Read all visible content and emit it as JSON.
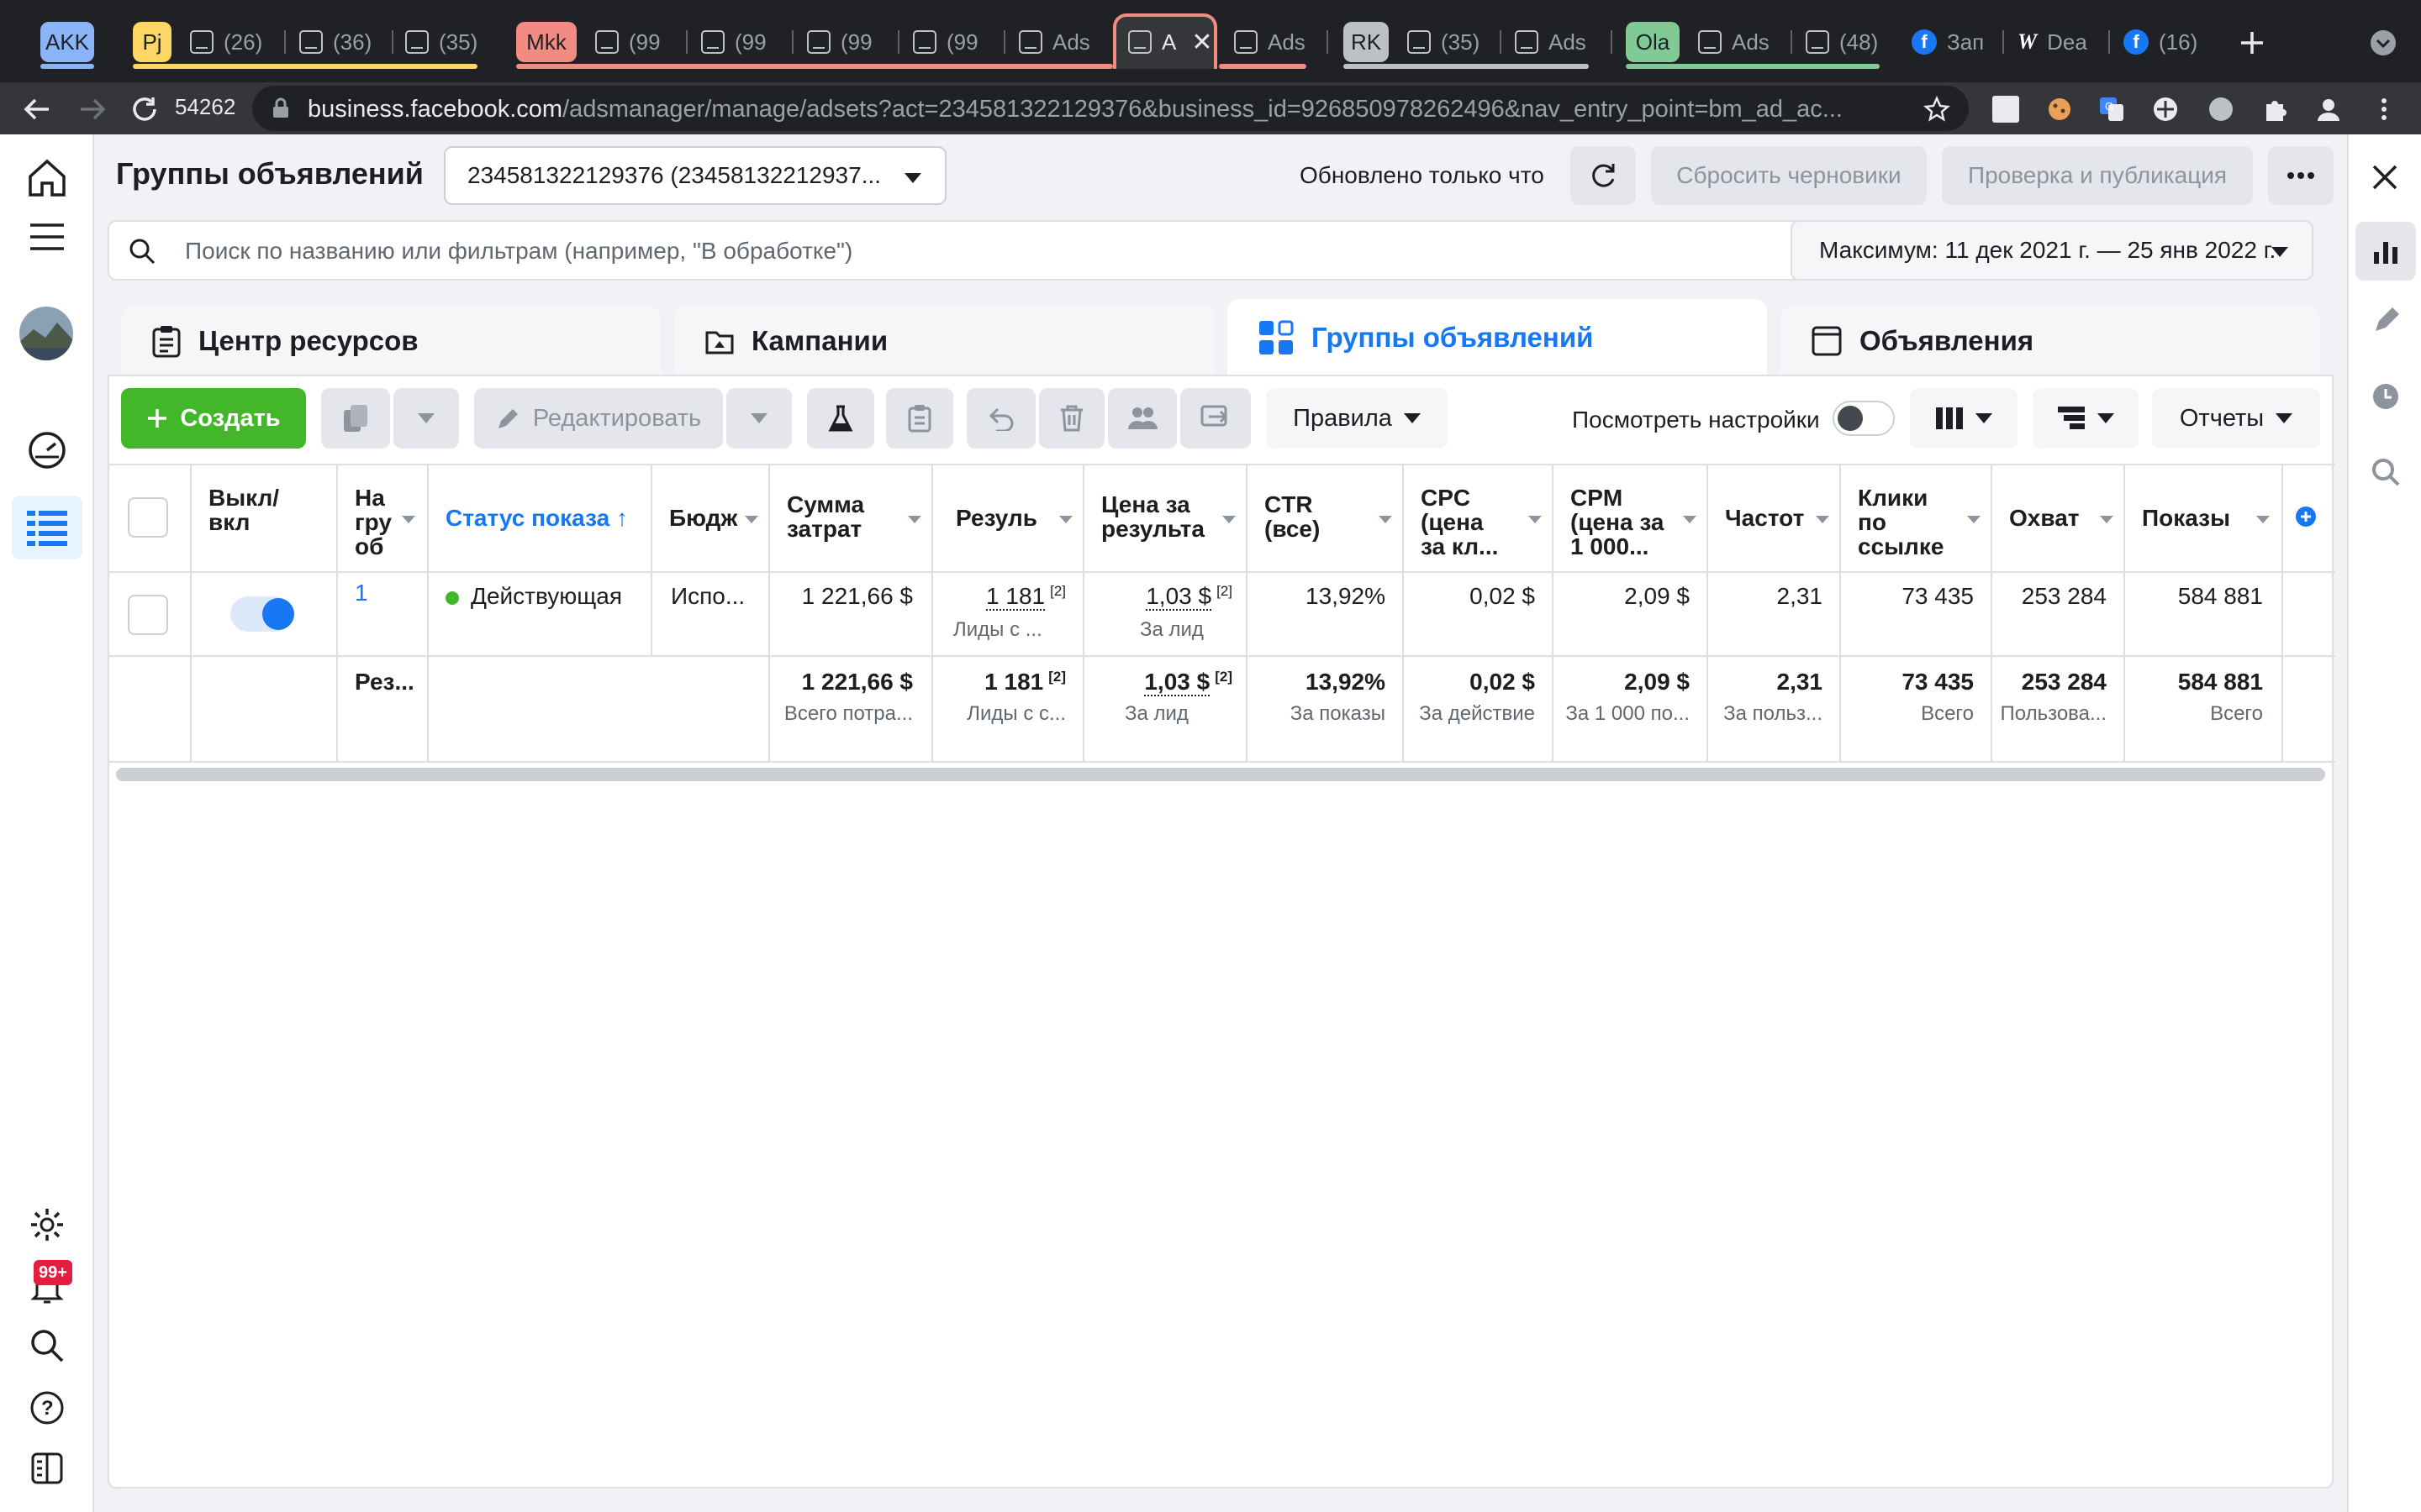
{
  "browser": {
    "tabs": {
      "g_akk": "AKK",
      "g_pj": "Pj",
      "t1": "(26)",
      "t2": "(36)",
      "t3": "(35)",
      "g_mkk": "Mkk",
      "t4": "(99",
      "t5": "(99",
      "t6": "(99",
      "t7": "(99",
      "t8": "Ads",
      "t9": "A",
      "t10": "Ads",
      "g_rk": "RK",
      "t11": "(35)",
      "t12": "Ads",
      "g_ola": "Ola",
      "t13": "Ads",
      "t14": "(48)",
      "t15": "Зап",
      "t16": "Dea",
      "t17": "(16)"
    },
    "toolbar": {
      "badge": "54262",
      "url_domain": "business.facebook.com",
      "url_path": "/adsmanager/manage/adsets?act=234581322129376&business_id=926850978262496&nav_entry_point=bm_ad_ac..."
    },
    "colors": {
      "akk": "#8ab4f8",
      "pj": "#fdd663",
      "mkk": "#f28b82",
      "rk": "#bdc1c6",
      "ola": "#81c995"
    }
  },
  "header": {
    "title": "Группы объявлений",
    "account": "234581322129376 (23458132212937...",
    "updated": "Обновлено только что",
    "discard": "Сбросить черновики",
    "publish": "Проверка и публикация"
  },
  "search": {
    "placeholder": "Поиск по названию или фильтрам (например, \"В обработке\")",
    "date_range": "Максимум: 11 дек 2021 г. — 25 янв 2022 г."
  },
  "level_tabs": {
    "resources": "Центр ресурсов",
    "campaigns": "Кампании",
    "adsets": "Группы объявлений",
    "ads": "Объявления"
  },
  "toolbar": {
    "create": "Создать",
    "edit": "Редактировать",
    "rules": "Правила",
    "view_settings": "Посмотреть настройки",
    "reports": "Отчеты"
  },
  "notifications": {
    "badge": "99+"
  },
  "table": {
    "headers": {
      "toggle": "Выкл/\nвкл",
      "name": "На\nгру\nоб",
      "status": "Статус показа ↑",
      "budget": "Бюдж",
      "spent": "Сумма\nзатрат",
      "results": "Резуль",
      "cpr": "Цена за\nрезульта",
      "ctr": "CTR\n(все)",
      "cpc": "CPC\n(цена\nза кл...",
      "cpm": "CPM\n(цена за\n1 000...",
      "freq": "Частот",
      "clicks": "Клики\nпо\nссылке",
      "reach": "Охват",
      "impr": "Показы"
    },
    "row": {
      "name": "1",
      "status": "Действующая",
      "budget": "Испо...",
      "spent": "1 221,66 $",
      "results": "1 181",
      "results_sup": "[2]",
      "results_sub": "Лиды с ...",
      "cpr": "1,03 $",
      "cpr_sup": "[2]",
      "cpr_sub": "За лид",
      "ctr": "13,92%",
      "cpc": "0,02 $",
      "cpm": "2,09 $",
      "freq": "2,31",
      "clicks": "73 435",
      "reach": "253 284",
      "impr": "584 881",
      "toggle_on": true
    },
    "totals": {
      "label": "Рез...",
      "spent": "1 221,66 $",
      "spent_sub": "Всего потра...",
      "results": "1 181",
      "results_sup": "[2]",
      "results_sub": "Лиды с с...",
      "cpr": "1,03 $",
      "cpr_sup": "[2]",
      "cpr_sub": "За лид",
      "ctr": "13,92%",
      "ctr_sub": "За показы",
      "cpc": "0,02 $",
      "cpc_sub": "За действие",
      "cpm": "2,09 $",
      "cpm_sub": "За 1 000 по...",
      "freq": "2,31",
      "freq_sub": "За польз...",
      "clicks": "73 435",
      "clicks_sub": "Всего",
      "reach": "253 284",
      "reach_sub": "Пользова...",
      "impr": "584 881",
      "impr_sub": "Всего"
    }
  }
}
